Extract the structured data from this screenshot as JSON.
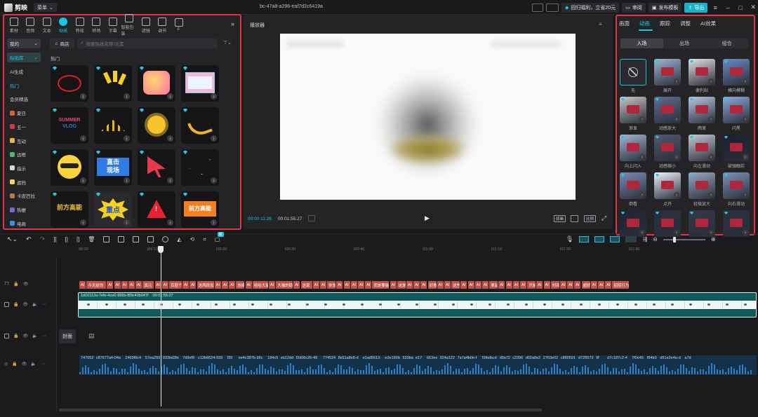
{
  "app": {
    "name": "剪映",
    "menu_label": "菜单",
    "project_title": "bc-47a8-a296-eaf7d2c6419a"
  },
  "titlebar": {
    "vip_label": "回归福利，立省20元",
    "review": "审阅",
    "publish_template": "发布模板",
    "export": "导出"
  },
  "tools": [
    "素材",
    "音频",
    "文本",
    "贴纸",
    "特效",
    "转场",
    "字幕",
    "智能包装",
    "滤镜",
    "调节",
    "F"
  ],
  "active_tool": "贴纸",
  "sticker_panel": {
    "mine_label": "我的",
    "shop_label": "商店",
    "sticker_dropdown": "贴纸库",
    "search_placeholder": "搜索贴纸名称/元素",
    "section_title": "热门",
    "sidebar": [
      "AI生成",
      "热门",
      "会员精选",
      "夏日",
      "五一",
      "互动",
      "边框",
      "指示",
      "遮挡",
      "卡皮巴拉",
      "热梗",
      "电商"
    ],
    "active_category": "热门",
    "stickers": [
      {
        "text": "",
        "type": "circle"
      },
      {
        "text": "",
        "type": "ticks"
      },
      {
        "text": "",
        "type": "candy"
      },
      {
        "text": "",
        "type": "windows"
      },
      {
        "text": "SUMMER VLOG",
        "type": "summer"
      },
      {
        "text": "",
        "type": "rays"
      },
      {
        "text": "",
        "type": "sun"
      },
      {
        "text": "",
        "type": "arrow"
      },
      {
        "text": "",
        "type": "cool"
      },
      {
        "text": "直击现场",
        "type": "live"
      },
      {
        "text": "",
        "type": "cursor"
      },
      {
        "text": "",
        "type": "plane"
      },
      {
        "text": "前方高能",
        "type": "gaoneng"
      },
      {
        "text": "重点",
        "type": "zhongdian"
      },
      {
        "text": "",
        "type": "warning"
      },
      {
        "text": "前方高能",
        "type": "gaoneng2"
      }
    ],
    "colors": {
      "accent": "#1bc6de",
      "red": "#e5334c"
    }
  },
  "player": {
    "title": "播放器",
    "current_time": "00:00:11:26",
    "total_time": "00:01:55:27",
    "buttons": [
      "原画",
      "比例"
    ]
  },
  "right_panel": {
    "tabs": [
      "画面",
      "动画",
      "跟踪",
      "调整",
      "AI效果"
    ],
    "active_tab": "动画",
    "segments": [
      "入场",
      "出场",
      "组合"
    ],
    "active_segment": "入场",
    "animations": [
      "无",
      "展开",
      "便利贴",
      "横向模糊",
      "渐显",
      "动感放大",
      "雨滚",
      "闪黑",
      "向上闪入",
      "动感缩小",
      "向左滑动",
      "破镜眼前",
      "倒看",
      "点开",
      "轻微放大",
      "向右滑动",
      "",
      "",
      "",
      ""
    ]
  },
  "timeline": {
    "ruler": [
      "00:00",
      "00:10",
      "00:20",
      "00:30",
      "00:40",
      "01:00",
      "01:10",
      "01:20",
      "01:30"
    ],
    "ruler_ticks": [
      "00:00",
      "|00:10",
      "|00:20",
      "|00:30",
      "|00:40",
      "|01:00",
      "|01:10",
      "|01:20",
      "|01:30"
    ],
    "badge": "新",
    "video_clip_name": "1d16112a-7efe-4ce0-955b-f89c40b047f",
    "video_clip_duration": "00:01:55:27",
    "cover_label": "封面",
    "text_clips": [
      "AI",
      "今天给你",
      "AI",
      "AI",
      "AI",
      "AI",
      "AI",
      "真元",
      "AI",
      "AI",
      "百层个",
      "AI",
      "AI",
      "这两段加",
      "AI",
      "AI",
      "AI",
      "热嫁",
      "AI",
      "哈哈大家",
      "AI",
      "大咖的助",
      "AI",
      "这家",
      "AI",
      "AI",
      "你觉",
      "AI",
      "AI",
      "AI",
      "AI",
      "AI",
      "而是要能",
      "AI",
      "这是",
      "AI",
      "AI",
      "AI",
      "好看",
      "AI",
      "AI",
      "这些",
      "AI",
      "AI",
      "AI",
      "AI",
      "拿起",
      "AI",
      "AI",
      "AI",
      "AI",
      "开始",
      "AI",
      "AI",
      "时间",
      "AI",
      "AI",
      "AI",
      "超好",
      "AI",
      "AI",
      "AI",
      "招招行为"
    ],
    "audio_clips": [
      "747052",
      "c87677a4-04a",
      "2465f9c4",
      "57ea259",
      "933bd3fe",
      "7d9ef9",
      "c12b6624-039",
      "f39",
      "ee4c387b-96c",
      "184c5",
      "eb12dd",
      "f2d06c26-48",
      "774524",
      "8d11a8e8-d",
      "e1ad5613-",
      "e2e160b",
      "533ba",
      "e17",
      "663ee",
      "324a122",
      "7a7a4b0e-f",
      "59bdbcd",
      "d9a72",
      "c2396",
      "d02a8e2",
      "2763e02",
      "c880591",
      "d728573",
      "9f",
      "d7c187c2-4",
      "7f0e45",
      "f84b0",
      "d51e2e4a-d",
      "a7d"
    ]
  }
}
